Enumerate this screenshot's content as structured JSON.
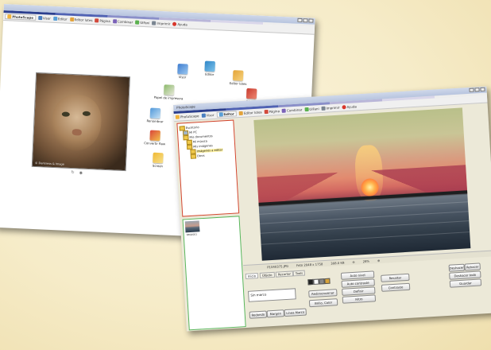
{
  "window1": {
    "title": "",
    "tabs": [
      "PhotoScape",
      "Visor",
      "Editor",
      "Editor lotes",
      "Página",
      "Combinar",
      "GIFani",
      "Imprimir",
      "Ayuda"
    ],
    "photo_credit": "© Darkness & Image",
    "ring_items": [
      "Visor",
      "Editor",
      "Editor lotes",
      "Página",
      "Papel de impresora",
      "Renombrar",
      "Convertir Raw",
      "Screen"
    ]
  },
  "window2": {
    "title": "PhotoScape",
    "tabs": [
      "PhotoScape",
      "Visor",
      "Editor",
      "Editor lotes",
      "Página",
      "Combinar",
      "GIFani",
      "Imprimir",
      "Ayuda"
    ],
    "tree": [
      "Escritorio",
      "Mi PC",
      "Mis documentos",
      "Mi música",
      "Mis imágenes",
      "Imágenes a editar",
      "Otros"
    ],
    "thumb_caption": "IMG0001",
    "status": {
      "filename": "P1040375.JPG",
      "dimensions": "Foto 2048 x 1758",
      "filesize": "308.0 KB",
      "zoom": "28%"
    },
    "tool_tabs": [
      "Inicio",
      "Objeto",
      "Recortar",
      "Tools"
    ],
    "frame_value": "Sin marco",
    "buttons_left": [
      "Redondo",
      "Margen",
      "Línea Marco"
    ],
    "buttons_mid": [
      "Auto nivel",
      "Auto contraste",
      "Definir",
      "Filtro"
    ],
    "buttons_mid2": [
      "Resaltar",
      "Contraste"
    ],
    "buttons_right": [
      "Guardar"
    ],
    "right_small": [
      "Deshacer",
      "Rehacer",
      "Deshacer todo"
    ],
    "bright_color": "Brillo, Color",
    "auto_label": "Redimensionar"
  }
}
